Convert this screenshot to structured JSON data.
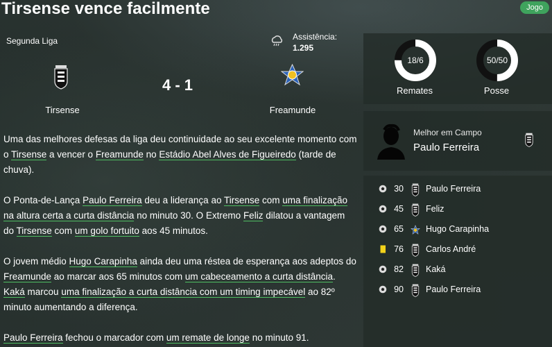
{
  "header": {
    "title": "Tirsense vence facilmente",
    "badge": "Jogo"
  },
  "match": {
    "league": "Segunda Liga",
    "attendance_label": "Assistência:",
    "attendance_value": "1.295",
    "score": "4 - 1",
    "home_team": "Tirsense",
    "away_team": "Freamunde",
    "weather_icon": "cloud-rain-icon"
  },
  "stats": {
    "shots": {
      "value": "18/6",
      "label": "Remates",
      "fraction_home": 0.75
    },
    "possession": {
      "value": "50/50",
      "label": "Posse",
      "fraction_home": 0.5
    }
  },
  "motm": {
    "label": "Melhor em Campo",
    "name": "Paulo Ferreira"
  },
  "events": [
    {
      "type": "goal",
      "minute": "30",
      "team": "home",
      "player": "Paulo Ferreira"
    },
    {
      "type": "goal",
      "minute": "45",
      "team": "home",
      "player": "Feliz"
    },
    {
      "type": "goal",
      "minute": "65",
      "team": "away",
      "player": "Hugo Carapinha"
    },
    {
      "type": "yellow-card",
      "minute": "76",
      "team": "home",
      "player": "Carlos André"
    },
    {
      "type": "goal",
      "minute": "82",
      "team": "home",
      "player": "Kaká"
    },
    {
      "type": "goal",
      "minute": "90",
      "team": "home",
      "player": "Paulo Ferreira"
    }
  ],
  "article": {
    "p1": [
      {
        "t": "Uma das melhores defesas da liga deu continuidade ao seu excelente momento com o "
      },
      {
        "t": "Tirsense",
        "u": true
      },
      {
        "t": " a vencer o "
      },
      {
        "t": "Freamunde",
        "u": true
      },
      {
        "t": " no "
      },
      {
        "t": "Estádio Abel Alves de Figueiredo",
        "u": true
      },
      {
        "t": " (tarde de chuva)."
      }
    ],
    "p2": [
      {
        "t": "O Ponta-de-Lança "
      },
      {
        "t": "Paulo Ferreira",
        "u": true
      },
      {
        "t": " deu a liderança ao "
      },
      {
        "t": "Tirsense",
        "u": true
      },
      {
        "t": " com "
      },
      {
        "t": "uma finalização na altura certa a curta distância",
        "u": true
      },
      {
        "t": " no minuto 30. O Extremo "
      },
      {
        "t": "Feliz",
        "u": true
      },
      {
        "t": " dilatou a vantagem do "
      },
      {
        "t": "Tirsense",
        "u": true
      },
      {
        "t": " com "
      },
      {
        "t": "um golo fortuito",
        "u": true
      },
      {
        "t": " aos 45 minutos."
      }
    ],
    "p3": [
      {
        "t": "O jovem médio "
      },
      {
        "t": "Hugo Carapinha",
        "u": true
      },
      {
        "t": " ainda deu uma réstea de esperança aos adeptos do "
      },
      {
        "t": "Freamunde",
        "u": true
      },
      {
        "t": " ao marcar aos 65 minutos com "
      },
      {
        "t": "um cabeceamento a curta distância",
        "u": true
      },
      {
        "t": ". "
      },
      {
        "t": "Kaká",
        "u": true
      },
      {
        "t": " marcou "
      },
      {
        "t": "uma finalização a curta distância com um timing impecável",
        "u": true
      },
      {
        "t": " ao 82º minuto aumentando a diferença."
      }
    ],
    "p4": [
      {
        "t": "Paulo Ferreira",
        "u": true
      },
      {
        "t": " fechou o marcador com "
      },
      {
        "t": "um remate de longe",
        "u": true
      },
      {
        "t": " no minuto 91."
      }
    ]
  }
}
